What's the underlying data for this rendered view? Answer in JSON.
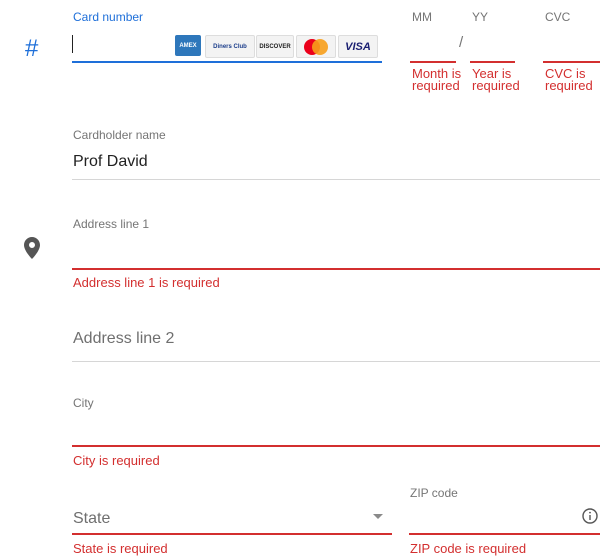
{
  "card": {
    "icon": "#",
    "number_label": "Card number",
    "brands": [
      "AMEX",
      "Diners Club",
      "DISCOVER",
      "MasterCard",
      "VISA"
    ],
    "mm_label": "MM",
    "yy_label": "YY",
    "cvc_label": "CVC",
    "separator": "/",
    "month_error": "Month is required",
    "year_error": "Year is required",
    "cvc_error": "CVC is required"
  },
  "cardholder": {
    "label": "Cardholder name",
    "value": "Prof David"
  },
  "address": {
    "icon": "location-pin",
    "line1_label": "Address line 1",
    "line1_error": "Address line 1 is required",
    "line2_placeholder": "Address line 2"
  },
  "city": {
    "label": "City",
    "error": "City is required"
  },
  "state": {
    "placeholder": "State",
    "error": "State is required"
  },
  "zip": {
    "label": "ZIP code",
    "error": "ZIP code is required",
    "info_icon": "info-icon"
  },
  "colors": {
    "accent": "#1e6fd9",
    "error": "#d32f2f"
  }
}
